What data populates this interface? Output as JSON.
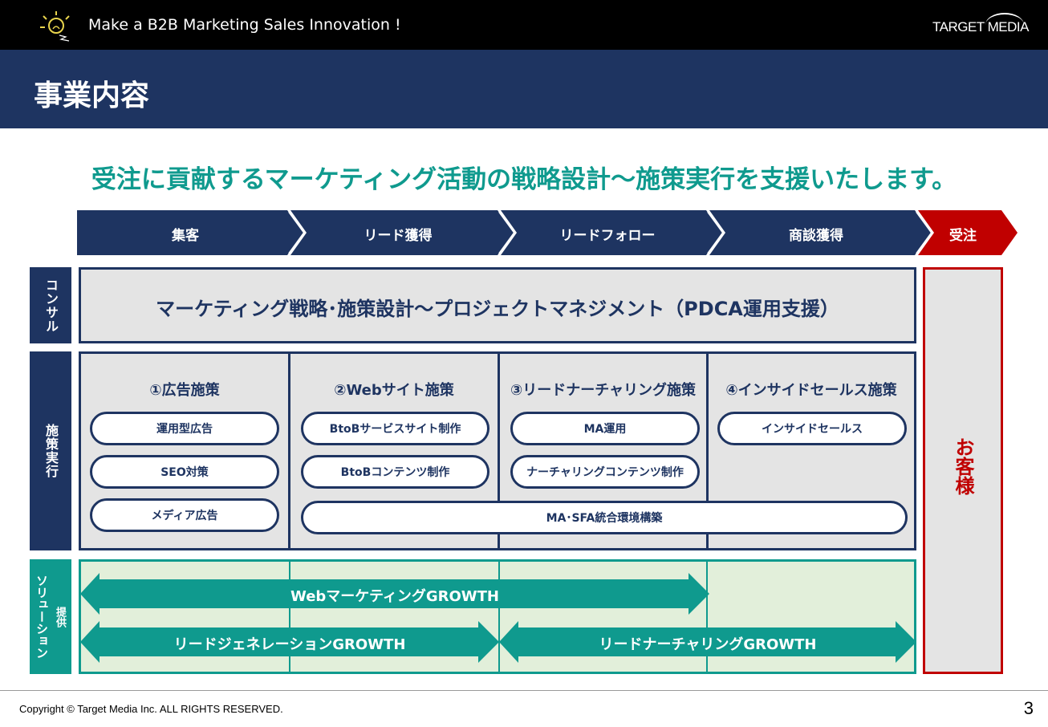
{
  "header": {
    "slogan": "Make a B2B Marketing Sales Innovation !",
    "brand": "TARGET MEDIA"
  },
  "page_title": "事業内容",
  "tagline": "受注に貢献するマーケティング活動の戦略設計～施策実行を支援いたします。",
  "stages": [
    "集客",
    "リード獲得",
    "リードフォロー",
    "商談獲得",
    "受注"
  ],
  "side_labels": {
    "consult": "コンサル",
    "execution": "施策実行",
    "solution_main": "ソリューション",
    "solution_sub": "提供"
  },
  "consult_text": "マーケティング戦略･施策設計～プロジェクトマネジメント（PDCA運用支援）",
  "measures": [
    {
      "title": "①広告施策",
      "items": [
        "運用型広告",
        "SEO対策",
        "メディア広告"
      ]
    },
    {
      "title": "②Webサイト施策",
      "items": [
        "BtoBサービスサイト制作",
        "BtoBコンテンツ制作"
      ]
    },
    {
      "title": "③リードナーチャリング施策",
      "items": [
        "MA運用",
        "ナーチャリングコンテンツ制作"
      ]
    },
    {
      "title": "④インサイドセールス施策",
      "items": [
        "インサイドセールス"
      ]
    }
  ],
  "shared_measure": "MA･SFA統合環境構築",
  "solutions": [
    "WebマーケティングGROWTH",
    "リードジェネレーションGROWTH",
    "リードナーチャリングGROWTH"
  ],
  "customer": "お客様",
  "footer": {
    "copyright": "Copyright © Target Media Inc. ALL RIGHTS RESERVED.",
    "page_number": "3"
  },
  "colors": {
    "navy": "#1e3461",
    "teal": "#0f9a8e",
    "red": "#c00000",
    "panel_gray": "#e4e4e4",
    "solution_bg": "#e2efda"
  }
}
